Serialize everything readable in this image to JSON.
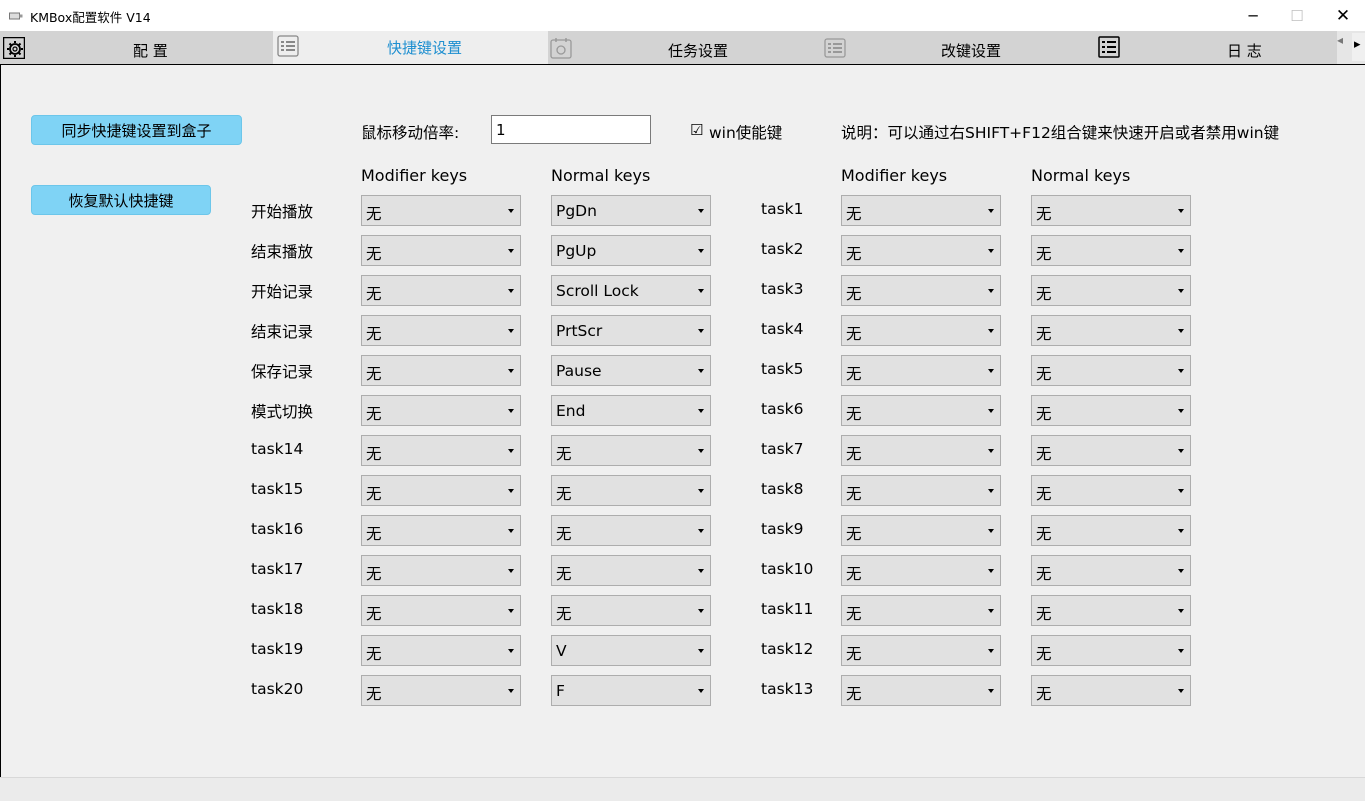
{
  "window": {
    "title": "KMBox配置软件 V14",
    "minimize_glyph": "─",
    "maximize_glyph": "☐",
    "close_glyph": "✕"
  },
  "tabs": [
    {
      "label": "配 置",
      "icon": "gear-icon",
      "active": false
    },
    {
      "label": "快捷键设置",
      "icon": "list-icon",
      "active": true
    },
    {
      "label": "任务设置",
      "icon": "calendar-icon",
      "active": false
    },
    {
      "label": "改键设置",
      "icon": "keyboard-icon",
      "active": false
    },
    {
      "label": "日 志",
      "icon": "log-icon",
      "active": false
    }
  ],
  "tab_scroll": {
    "left_glyph": "◂",
    "right_glyph": "▸"
  },
  "buttons": {
    "sync": "同步快捷键设置到盒子",
    "restore": "恢复默认快捷键"
  },
  "mouse": {
    "label": "鼠标移动倍率:",
    "value": "1"
  },
  "win_key": {
    "check_glyph": "☑",
    "label": "win使能键",
    "checked": true
  },
  "note": "说明：可以通过右SHIFT+F12组合键来快速开启或者禁用win键",
  "headers": {
    "modifier": "Modifier keys",
    "normal": "Normal keys"
  },
  "left_rows": [
    {
      "name": "开始播放",
      "modifier": "无",
      "normal": "PgDn"
    },
    {
      "name": "结束播放",
      "modifier": "无",
      "normal": "PgUp"
    },
    {
      "name": "开始记录",
      "modifier": "无",
      "normal": "Scroll Lock"
    },
    {
      "name": "结束记录",
      "modifier": "无",
      "normal": "PrtScr"
    },
    {
      "name": "保存记录",
      "modifier": "无",
      "normal": "Pause"
    },
    {
      "name": "模式切换",
      "modifier": "无",
      "normal": "End"
    },
    {
      "name": "task14",
      "modifier": "无",
      "normal": "无"
    },
    {
      "name": "task15",
      "modifier": "无",
      "normal": "无"
    },
    {
      "name": "task16",
      "modifier": "无",
      "normal": "无"
    },
    {
      "name": "task17",
      "modifier": "无",
      "normal": "无"
    },
    {
      "name": "task18",
      "modifier": "无",
      "normal": "无"
    },
    {
      "name": "task19",
      "modifier": "无",
      "normal": "V"
    },
    {
      "name": "task20",
      "modifier": "无",
      "normal": "F"
    }
  ],
  "right_rows": [
    {
      "name": "task1",
      "modifier": "无",
      "normal": "无"
    },
    {
      "name": "task2",
      "modifier": "无",
      "normal": "无"
    },
    {
      "name": "task3",
      "modifier": "无",
      "normal": "无"
    },
    {
      "name": "task4",
      "modifier": "无",
      "normal": "无"
    },
    {
      "name": "task5",
      "modifier": "无",
      "normal": "无"
    },
    {
      "name": "task6",
      "modifier": "无",
      "normal": "无"
    },
    {
      "name": "task7",
      "modifier": "无",
      "normal": "无"
    },
    {
      "name": "task8",
      "modifier": "无",
      "normal": "无"
    },
    {
      "name": "task9",
      "modifier": "无",
      "normal": "无"
    },
    {
      "name": "task10",
      "modifier": "无",
      "normal": "无"
    },
    {
      "name": "task11",
      "modifier": "无",
      "normal": "无"
    },
    {
      "name": "task12",
      "modifier": "无",
      "normal": "无"
    },
    {
      "name": "task13",
      "modifier": "无",
      "normal": "无"
    }
  ],
  "colors": {
    "accent_button": "#7fd3f5",
    "active_tab_text": "#1e8fd0"
  }
}
